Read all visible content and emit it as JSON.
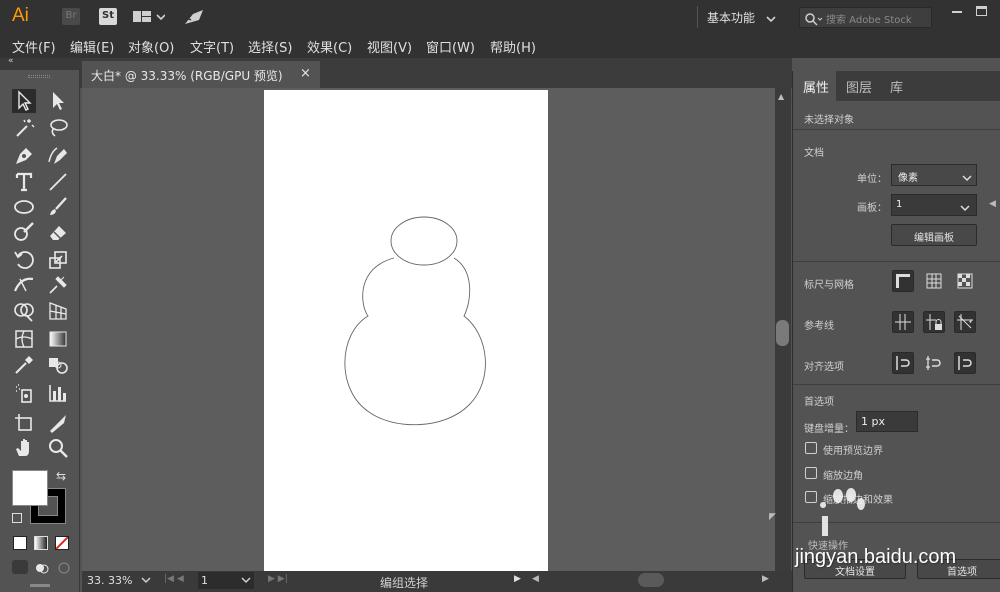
{
  "app": {
    "logo": "Ai",
    "bridge": "Br",
    "stock": "St"
  },
  "workspace": {
    "label": "基本功能",
    "search_placeholder": "搜索 Adobe Stock"
  },
  "menu": [
    "文件(F)",
    "编辑(E)",
    "对象(O)",
    "文字(T)",
    "选择(S)",
    "效果(C)",
    "视图(V)",
    "窗口(W)",
    "帮助(H)"
  ],
  "document": {
    "tab_title": "大白* @ 33.33% (RGB/GPU 预览)",
    "close_glyph": "×"
  },
  "status": {
    "zoom": "33. 33%",
    "artboard_index": "1",
    "tool_hint": "编组选择"
  },
  "panel": {
    "tabs": [
      "属性",
      "图层",
      "库"
    ],
    "no_selection": "未选择对象",
    "doc_section": "文档",
    "unit_label": "单位：",
    "unit_value": "像素",
    "artboard_label": "画板：",
    "artboard_value": "1",
    "edit_artboards": "编辑画板",
    "rulers_grids": "标尺与网格",
    "guides": "参考线",
    "snap_options": "对齐选项",
    "preferences": "首选项",
    "keyboard_inc_label": "键盘增量：",
    "keyboard_inc_value": "1 px",
    "checkboxes": [
      "使用预览边界",
      "缩放边角",
      "缩放描边和效果"
    ],
    "quick_actions": "快速操作",
    "doc_settings": "文档设置",
    "prefs_button": "首选项"
  },
  "watermark": "jingyan.baidu.com",
  "colors": {
    "accent": "#ff9a00",
    "fill": "#ffffff",
    "stroke": "#000000",
    "none_slash": "#e2251d"
  }
}
